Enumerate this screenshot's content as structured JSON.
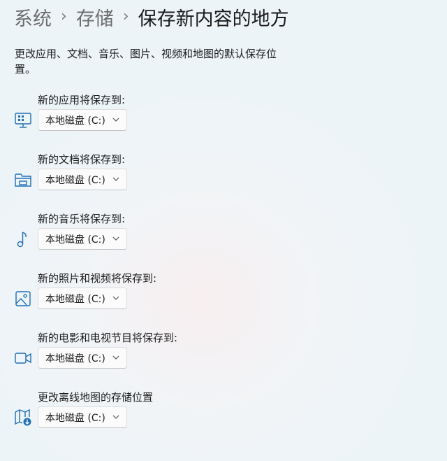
{
  "breadcrumb": {
    "level1": "系统",
    "level2": "存储",
    "current": "保存新内容的地方"
  },
  "description": "更改应用、文档、音乐、图片、视频和地图的默认保存位置。",
  "settings": [
    {
      "label": "新的应用将保存到:",
      "icon": "app-monitor-icon",
      "value": "本地磁盘 (C:)"
    },
    {
      "label": "新的文档将保存到:",
      "icon": "folder-document-icon",
      "value": "本地磁盘 (C:)"
    },
    {
      "label": "新的音乐将保存到:",
      "icon": "music-note-icon",
      "value": "本地磁盘 (C:)"
    },
    {
      "label": "新的照片和视频将保存到:",
      "icon": "image-icon",
      "value": "本地磁盘 (C:)"
    },
    {
      "label": "新的电影和电视节目将保存到:",
      "icon": "video-camera-icon",
      "value": "本地磁盘 (C:)"
    },
    {
      "label": "更改离线地图的存储位置",
      "icon": "map-download-icon",
      "value": "本地磁盘 (C:)"
    }
  ]
}
